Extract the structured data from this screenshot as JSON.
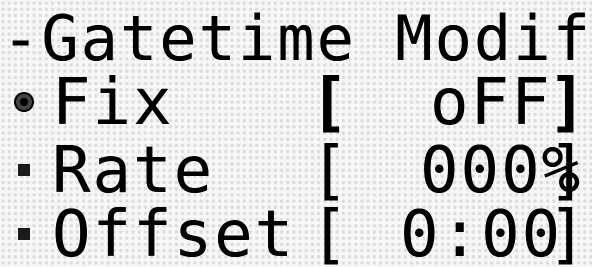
{
  "screen": {
    "title": "-Gatetime Modify-",
    "items": [
      {
        "label": "Fix",
        "open_bracket": "[",
        "value": "oFF",
        "close_bracket": "]",
        "selected": true
      },
      {
        "label": "Rate",
        "open_bracket": "[",
        "value": "000%",
        "close_bracket": "]",
        "selected": false
      },
      {
        "label": "Offset",
        "open_bracket": "[",
        "value": "0:00",
        "close_bracket": "]",
        "selected": false
      }
    ]
  }
}
